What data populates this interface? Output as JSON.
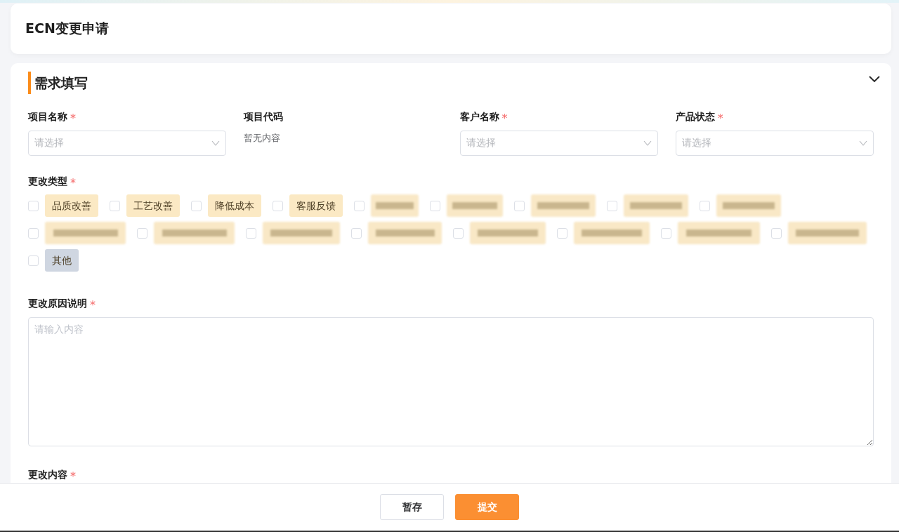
{
  "header": {
    "title": "ECN变更申请"
  },
  "section": {
    "title": "需求填写",
    "expanded": true
  },
  "fields": [
    {
      "kind": "select",
      "label": "项目名称",
      "required_mark": "*",
      "placeholder": "请选择"
    },
    {
      "kind": "text",
      "label": "项目代码",
      "value": "暂无内容"
    },
    {
      "kind": "select",
      "label": "客户名称",
      "required_mark": "*",
      "placeholder": "请选择"
    },
    {
      "kind": "select",
      "label": "产品状态",
      "required_mark": "*",
      "placeholder": "请选择"
    }
  ],
  "change_type": {
    "label": "更改类型",
    "required_mark": "*",
    "options": [
      {
        "kind": "tag",
        "label": "品质改善",
        "checked": false,
        "color": "#fbe9c4"
      },
      {
        "kind": "tag",
        "label": "工艺改善",
        "checked": false,
        "color": "#fbe9c4"
      },
      {
        "kind": "tag",
        "label": "降低成本",
        "checked": false,
        "color": "#fbe9c4"
      },
      {
        "kind": "tag",
        "label": "客服反馈",
        "checked": false,
        "color": "#fbe9c4"
      },
      {
        "kind": "redacted",
        "checked": false
      },
      {
        "kind": "redacted",
        "checked": false
      },
      {
        "kind": "redacted",
        "checked": false
      },
      {
        "kind": "redacted",
        "checked": false
      },
      {
        "kind": "redacted",
        "checked": false
      },
      {
        "kind": "redacted",
        "checked": false
      },
      {
        "kind": "redacted",
        "checked": false
      },
      {
        "kind": "redacted",
        "checked": false
      },
      {
        "kind": "redacted",
        "checked": false
      },
      {
        "kind": "redacted",
        "checked": false
      },
      {
        "kind": "redacted",
        "checked": false
      },
      {
        "kind": "redacted",
        "checked": false
      },
      {
        "kind": "redacted",
        "checked": false
      },
      {
        "kind": "tag",
        "label": "其他",
        "checked": false,
        "color": "#cfd6e1"
      }
    ]
  },
  "reason": {
    "label": "更改原因说明",
    "required_mark": "*",
    "placeholder": "请输入内容"
  },
  "content": {
    "label": "更改内容",
    "required_mark": "*"
  },
  "footer": {
    "buttons": [
      {
        "kind": "secondary",
        "label": "暂存"
      },
      {
        "kind": "primary",
        "label": "提交"
      }
    ]
  }
}
